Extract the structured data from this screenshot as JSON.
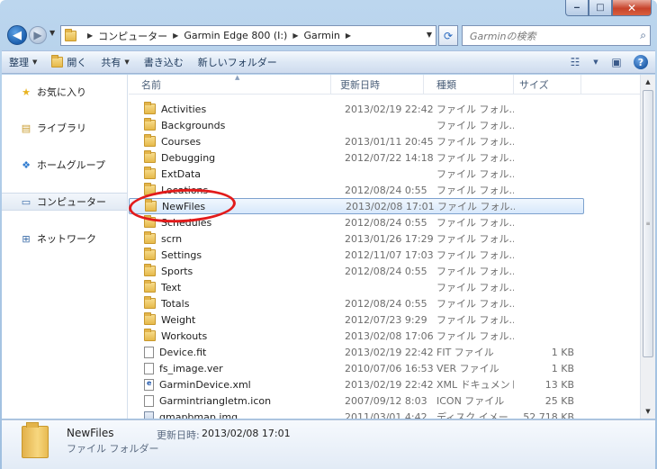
{
  "window": {
    "minimize": "‒",
    "maximize": "□",
    "close": "✕"
  },
  "address": {
    "crumbs": [
      "コンピューター",
      "Garmin Edge 800 (I:)",
      "Garmin"
    ],
    "search_placeholder": "Garminの検索"
  },
  "toolbar": {
    "organize": "整理",
    "open": "開く",
    "share": "共有",
    "burn": "書き込む",
    "new_folder": "新しいフォルダー"
  },
  "nav": {
    "items": [
      {
        "label": "お気に入り",
        "icon": "star-icon"
      },
      {
        "label": "ライブラリ",
        "icon": "library-icon"
      },
      {
        "label": "ホームグループ",
        "icon": "homegroup-icon"
      },
      {
        "label": "コンピューター",
        "icon": "computer-icon"
      },
      {
        "label": "ネットワーク",
        "icon": "network-icon"
      }
    ]
  },
  "columns": {
    "name": "名前",
    "date": "更新日時",
    "type": "種類",
    "size": "サイズ"
  },
  "files": [
    {
      "name": "Activities",
      "date": "2013/02/19 22:42",
      "type": "ファイル フォル...",
      "size": "",
      "kind": "folder"
    },
    {
      "name": "Backgrounds",
      "date": "",
      "type": "ファイル フォル...",
      "size": "",
      "kind": "folder"
    },
    {
      "name": "Courses",
      "date": "2013/01/11 20:45",
      "type": "ファイル フォル...",
      "size": "",
      "kind": "folder"
    },
    {
      "name": "Debugging",
      "date": "2012/07/22 14:18",
      "type": "ファイル フォル...",
      "size": "",
      "kind": "folder"
    },
    {
      "name": "ExtData",
      "date": "",
      "type": "ファイル フォル...",
      "size": "",
      "kind": "folder"
    },
    {
      "name": "Locations",
      "date": "2012/08/24 0:55",
      "type": "ファイル フォル...",
      "size": "",
      "kind": "folder"
    },
    {
      "name": "NewFiles",
      "date": "2013/02/08 17:01",
      "type": "ファイル フォル...",
      "size": "",
      "kind": "folder",
      "selected": true
    },
    {
      "name": "Schedules",
      "date": "2012/08/24 0:55",
      "type": "ファイル フォル...",
      "size": "",
      "kind": "folder"
    },
    {
      "name": "scrn",
      "date": "2013/01/26 17:29",
      "type": "ファイル フォル...",
      "size": "",
      "kind": "folder"
    },
    {
      "name": "Settings",
      "date": "2012/11/07 17:03",
      "type": "ファイル フォル...",
      "size": "",
      "kind": "folder"
    },
    {
      "name": "Sports",
      "date": "2012/08/24 0:55",
      "type": "ファイル フォル...",
      "size": "",
      "kind": "folder"
    },
    {
      "name": "Text",
      "date": "",
      "type": "ファイル フォル...",
      "size": "",
      "kind": "folder"
    },
    {
      "name": "Totals",
      "date": "2012/08/24 0:55",
      "type": "ファイル フォル...",
      "size": "",
      "kind": "folder"
    },
    {
      "name": "Weight",
      "date": "2012/07/23 9:29",
      "type": "ファイル フォル...",
      "size": "",
      "kind": "folder"
    },
    {
      "name": "Workouts",
      "date": "2013/02/08 17:06",
      "type": "ファイル フォル...",
      "size": "",
      "kind": "folder"
    },
    {
      "name": "Device.fit",
      "date": "2013/02/19 22:42",
      "type": "FIT ファイル",
      "size": "1 KB",
      "kind": "file"
    },
    {
      "name": "fs_image.ver",
      "date": "2010/07/06 16:53",
      "type": "VER ファイル",
      "size": "1 KB",
      "kind": "file"
    },
    {
      "name": "GarminDevice.xml",
      "date": "2013/02/19 22:42",
      "type": "XML ドキュメント",
      "size": "13 KB",
      "kind": "xml"
    },
    {
      "name": "Garmintriangletm.icon",
      "date": "2007/09/12 8:03",
      "type": "ICON ファイル",
      "size": "25 KB",
      "kind": "file"
    },
    {
      "name": "gmapbmap.img",
      "date": "2011/03/01 4:42",
      "type": "ディスク イメー...",
      "size": "52,718 KB",
      "kind": "img"
    }
  ],
  "details": {
    "name": "NewFiles",
    "type": "ファイル フォルダー",
    "modified_label": "更新日時:",
    "modified_value": "2013/02/08 17:01"
  },
  "colors": {
    "accent": "#1b5fae",
    "selection_border": "#7da2ce",
    "annotation": "#e21b1b"
  }
}
